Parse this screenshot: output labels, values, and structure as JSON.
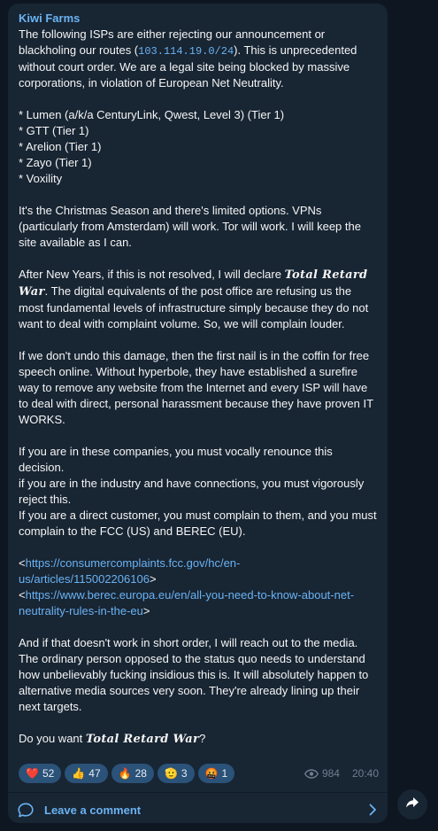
{
  "post": {
    "channel": "Kiwi Farms",
    "p1_a": "The following ISPs are either rejecting our announcement or blackholing our routes (",
    "p1_ip": "103.114.19.0/24",
    "p1_b": "). This is unprecedented without court order. We are a legal site being blocked by massive corporations, in violation of European Net Neutrality.",
    "isps": [
      "* Lumen (a/k/a CenturyLink, Qwest, Level 3) (Tier 1)",
      "* GTT (Tier 1)",
      "* Arelion (Tier 1)",
      "* Zayo (Tier 1)",
      "* Voxility"
    ],
    "p3": "It's the Christmas Season and there's limited options. VPNs (particularly from Amsterdam) will work. Tor will work. I will keep the site available as I can.",
    "p4_a": "After New Years, if this is not resolved, I will declare ",
    "p4_gothic": "Total Retard War",
    "p4_b": ". The digital equivalents of the post office are refusing us the most fundamental levels of infrastructure simply because they do not want to deal with complaint volume. So, we will complain louder.",
    "p5": "If we don't undo this damage, then the first nail is in the coffin for free speech online. Without hyperbole, they have established a surefire way to remove any website from the Internet and every ISP will have to deal with direct, personal harassment because they have proven IT WORKS.",
    "p6_1": "If you are in these companies, you must vocally renounce this decision.",
    "p6_2": "if you are in the industry and have connections, you must vigorously reject this.",
    "p6_3": "If you are a direct customer, you must complain to them, and you must complain to the FCC (US) and BEREC (EU).",
    "link1_open": "<",
    "link1": "https://consumercomplaints.fcc.gov/hc/en-us/articles/115002206106",
    "link1_close": ">",
    "link2_open": "<",
    "link2": "https://www.berec.europa.eu/en/all-you-need-to-know-about-net-neutrality-rules-in-the-eu",
    "link2_close": ">",
    "p8": "And if that doesn't work in short order, I will reach out to the media. The ordinary person opposed to the status quo needs to understand how unbelievably fucking insidious this is. It will absolutely happen to alternative media sources very soon. They're already lining up their next targets.",
    "p9_a": "Do you want ",
    "p9_gothic": "Total Retard War",
    "p9_b": "?"
  },
  "reactions": [
    {
      "emoji": "❤️",
      "icon": "red-heart",
      "count": "52"
    },
    {
      "emoji": "👍",
      "icon": "thumbs-up",
      "count": "47"
    },
    {
      "emoji": "🔥",
      "icon": "fire",
      "count": "28"
    },
    {
      "emoji": "🫡",
      "icon": "salute-hand",
      "count": "3"
    },
    {
      "emoji": "🤬",
      "icon": "cursing-face",
      "count": "1"
    }
  ],
  "meta": {
    "views": "984",
    "time": "20:40"
  },
  "comments": {
    "label": "Leave a comment"
  },
  "colors": {
    "background": "#0e1621",
    "bubble": "#182533",
    "accent": "#6ab3f3",
    "reaction_pill": "#2b5278"
  }
}
